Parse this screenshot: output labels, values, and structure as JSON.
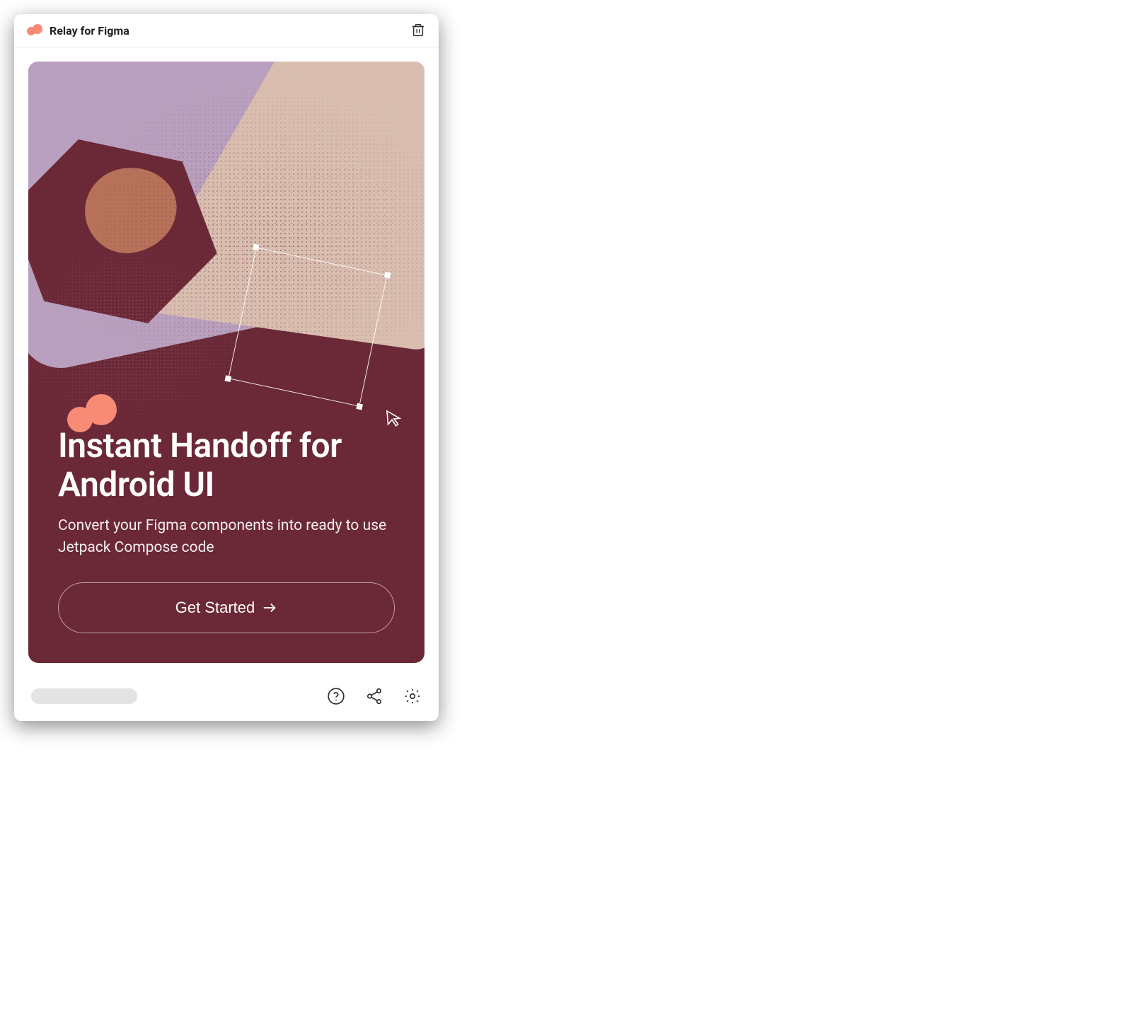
{
  "header": {
    "title": "Relay for Figma",
    "logo_icon": "relay-logo",
    "trash_icon": "trash-icon"
  },
  "hero": {
    "headline": "Instant Handoff for Android UI",
    "subhead": "Convert your Figma components into ready to use Jetpack Compose code",
    "cta_label": "Get Started",
    "cta_icon": "arrow-right-icon",
    "logo_icon": "relay-logo",
    "cursor_icon": "cursor-icon",
    "colors": {
      "background": "#6b2837",
      "accent": "#f88b75",
      "lilac": "#b9a0bf",
      "tan": "#d9beb0",
      "circle": "#b77259"
    }
  },
  "footer": {
    "help_icon": "help-icon",
    "share_icon": "share-icon",
    "settings_icon": "settings-icon"
  }
}
